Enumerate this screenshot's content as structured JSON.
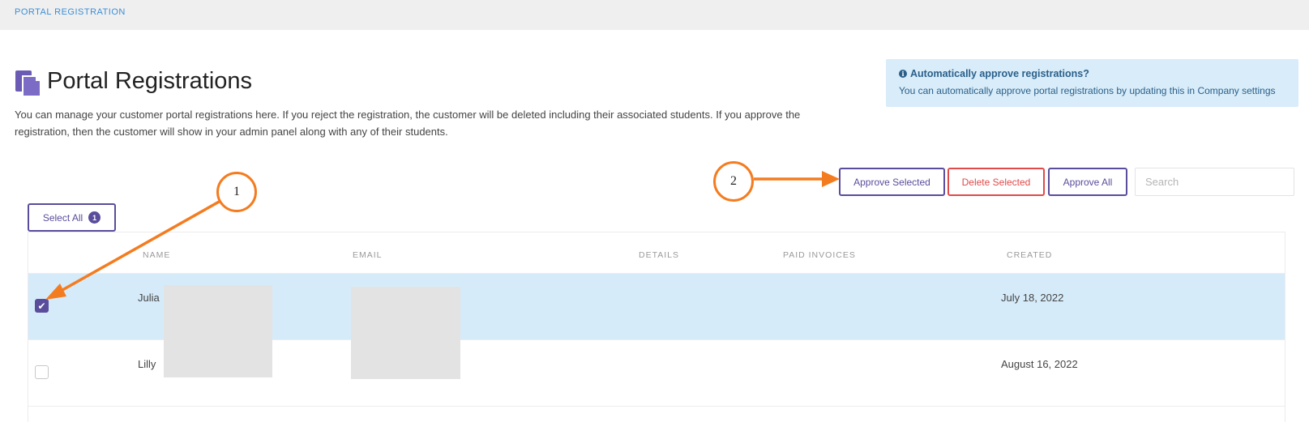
{
  "breadcrumb": "PORTAL REGISTRATION",
  "page": {
    "title": "Portal Registrations",
    "icon": "document-stack-icon",
    "description": "You can manage your customer portal registrations here. If you reject the registration, the customer will be deleted including their associated students. If you approve the registration, then the customer will show in your admin panel along with any of their students."
  },
  "info_box": {
    "icon": "info-icon",
    "title": "Automatically approve registrations?",
    "text": "You can automatically approve portal registrations by updating this in Company settings"
  },
  "toolbar": {
    "approve_selected": "Approve Selected",
    "delete_selected": "Delete Selected",
    "approve_all": "Approve All",
    "search_placeholder": "Search"
  },
  "select_all": {
    "label": "Select All",
    "count": "1"
  },
  "table": {
    "headers": [
      "NAME",
      "EMAIL",
      "DETAILS",
      "PAID INVOICES",
      "CREATED"
    ],
    "rows": [
      {
        "name": "Julia",
        "email": "",
        "details": "",
        "paid_invoices": "",
        "created": "July 18, 2022",
        "selected": true
      },
      {
        "name": "Lilly",
        "email": "",
        "details": "",
        "paid_invoices": "",
        "created": "August 16, 2022",
        "selected": false
      }
    ]
  },
  "annotations": {
    "step1": "1",
    "step2": "2",
    "color": "#f47c20"
  },
  "colors": {
    "primary": "#5a4d9c",
    "danger": "#e14a4a",
    "selected_row": "#d6ebf9",
    "info_bg": "#d8ecf9",
    "breadcrumb": "#3b8fd6"
  }
}
